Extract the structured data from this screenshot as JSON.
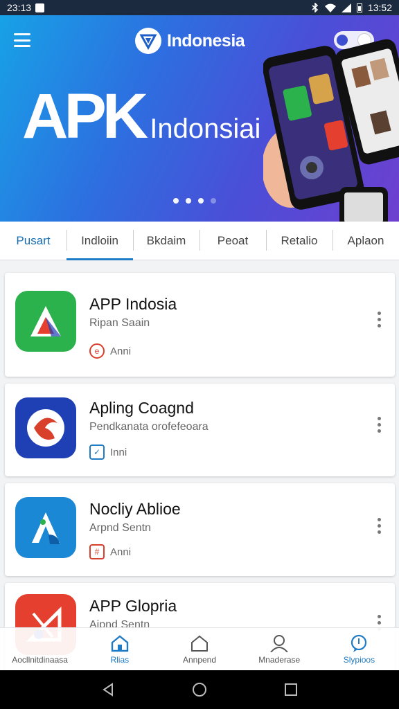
{
  "status_bar": {
    "time": "23:13",
    "right_text": "13:52"
  },
  "header": {
    "brand_name": "Indonesia"
  },
  "hero": {
    "title_big": "APK",
    "title_small": "Indonsiai",
    "carousel_index": 1,
    "carousel_count": 4
  },
  "tabs": [
    {
      "label": "Pusart"
    },
    {
      "label": "Indloiin"
    },
    {
      "label": "Bkdaim"
    },
    {
      "label": "Peoat"
    },
    {
      "label": "Retalio"
    },
    {
      "label": "Aplaon"
    }
  ],
  "apps": [
    {
      "name": "APP Indosia",
      "subtitle": "Ripan Saain",
      "meta": "Anni",
      "icon": "a-triangle-icon",
      "icon_bg": "#2bb24c",
      "meta_color": "#d9402b"
    },
    {
      "name": "Apling Coagnd",
      "subtitle": "Pendkanata orofefeoara",
      "meta": "Inni",
      "icon": "swirl-icon",
      "icon_bg": "#1f3fb5",
      "meta_color": "#1f7bc4"
    },
    {
      "name": "Nocliy Ablioe",
      "subtitle": "Arpnd Sentn",
      "meta": "Anni",
      "icon": "letter-a-icon",
      "icon_bg": "#1b88d6",
      "meta_color": "#d9402b"
    },
    {
      "name": "APP Glopria",
      "subtitle": "Aipnd Sentn",
      "meta": "",
      "icon": "triangle-icon",
      "icon_bg": "#e5402f",
      "meta_color": "#d9402b"
    }
  ],
  "bottom_nav": [
    {
      "label": "Aocllnitdinaasa",
      "icon": "app-icon"
    },
    {
      "label": "Rlias",
      "icon": "home-icon"
    },
    {
      "label": "Annpend",
      "icon": "house-icon"
    },
    {
      "label": "Mnaderase",
      "icon": "person-icon"
    },
    {
      "label": "Slypioos",
      "icon": "chat-icon"
    }
  ],
  "colors": {
    "accent": "#1f7bc4",
    "hero_start": "#17a2e6",
    "hero_end": "#6e3fcf"
  }
}
